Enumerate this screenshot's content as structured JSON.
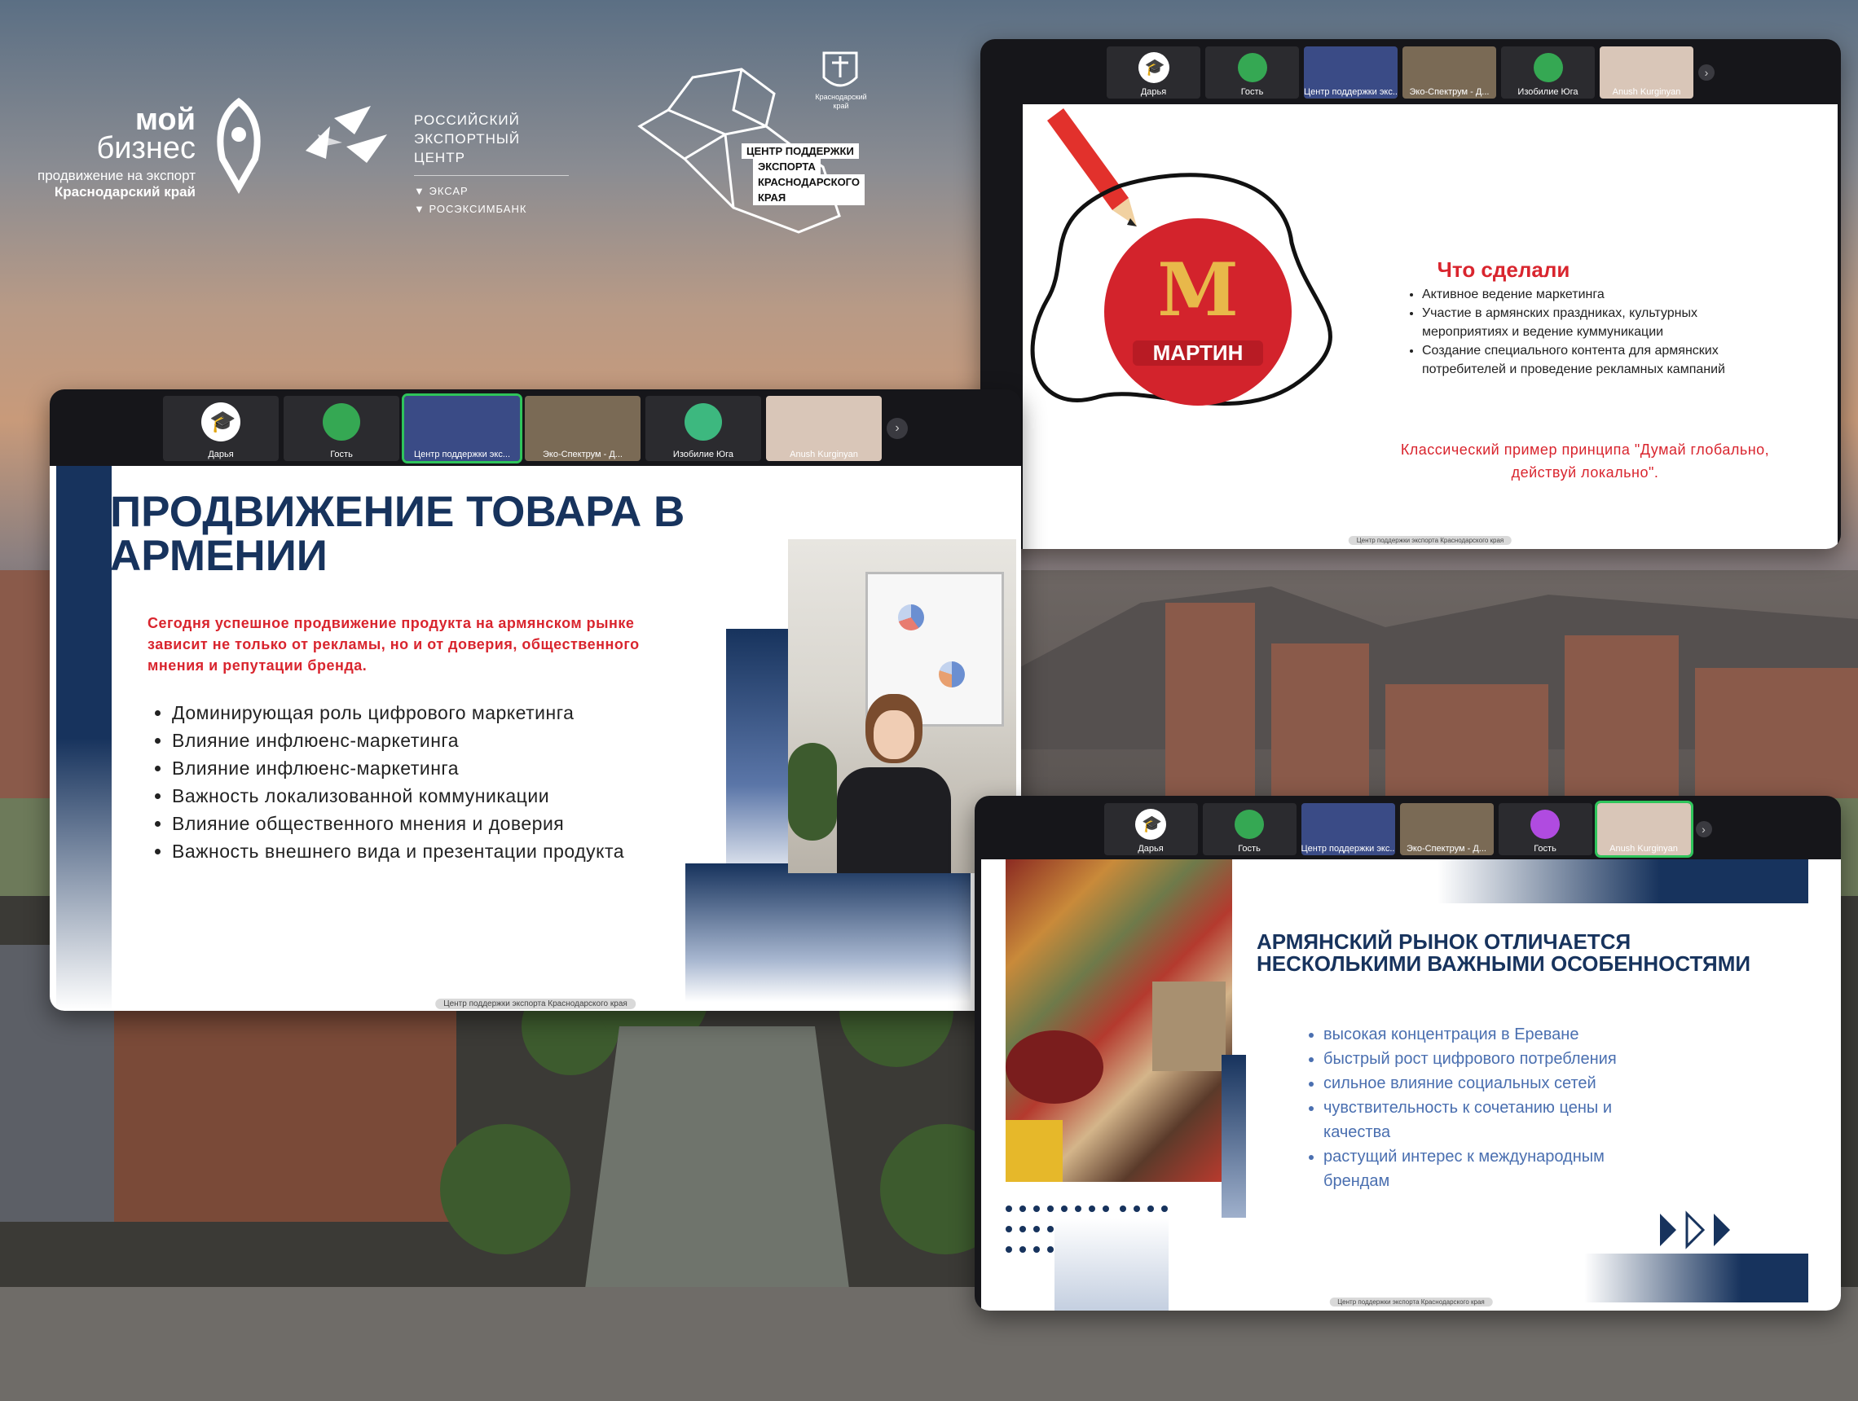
{
  "logos": {
    "moy_biznes_line1": "мой",
    "moy_biznes_line2": "бизнес",
    "moy_biznes_sub1": "продвижение на экспорт",
    "moy_biznes_sub2": "Краснодарский край",
    "rec_line1": "РОССИЙСКИЙ",
    "rec_line2": "ЭКСПОРТНЫЙ ЦЕНТР",
    "exar": "ЭКСАР",
    "roseximbank": "РОСЭКСИМБАНК",
    "center_line1": "ЦЕНТР ПОДДЕРЖКИ",
    "center_line2": "ЭКСПОРТА",
    "center_line3": "КРАСНОДАРСКОГО КРАЯ",
    "kuban_caption": "Краснодарский край"
  },
  "participants_a": [
    "Дарья",
    "Гость",
    "Центр поддержки экс...",
    "Эко-Спектрум - Д...",
    "Изобилие Юга",
    "Anush Kurginyan"
  ],
  "participants_b": [
    "Дарья",
    "Гость",
    "Центр поддержки экс...",
    "Эко-Спектрум - Д...",
    "Изобилие Юга",
    "Anush Kurginyan"
  ],
  "participants_c": [
    "Дарья",
    "Гость",
    "Центр поддержки экс...",
    "Эко-Спектрум - Д...",
    "Гость",
    "Anush Kurginyan"
  ],
  "chevron": "›",
  "slide_martin": {
    "brand": "МАРТИН",
    "brand_letter": "М",
    "title": "Что сделали",
    "bullets": [
      "Активное ведение маркетинга",
      "Участие в армянских праздниках, культурных мероприятиях и ведение куммуникации",
      "Создание специального контента для армянских потребителей и проведение рекламных кампаний"
    ],
    "quote": "Классический пример принципа \"Думай глобально, действуй локально\".",
    "caption": "Центр поддержки экспорта Краснодарского края"
  },
  "slide_promo": {
    "title": "ПРОДВИЖЕНИЕ ТОВАРА В АРМЕНИИ",
    "lead": "Сегодня успешное продвижение продукта на армянском рынке зависит не только от рекламы, но и от доверия, общественного мнения и репутации бренда.",
    "bullets": [
      "Доминирующая роль цифрового маркетинга",
      "Влияние инфлюенс-маркетинга",
      "Влияние инфлюенс-маркетинга",
      "Важность локализованной коммуникации",
      "Влияние общественного мнения и доверия",
      "Важность внешнего вида и презентации продукта"
    ],
    "caption": "Центр поддержки экспорта Краснодарского края"
  },
  "slide_market": {
    "title_line1": "АРМЯНСКИЙ РЫНОК ОТЛИЧАЕТСЯ",
    "title_line2": "НЕСКОЛЬКИМИ ВАЖНЫМИ ОСОБЕННОСТЯМИ",
    "bullets": [
      "высокая концентрация в Ереване",
      "быстрый рост цифрового потребления",
      "сильное влияние социальных сетей",
      "чувствительность к сочетанию цены и качества",
      "растущий интерес к международным брендам"
    ],
    "caption": "Центр поддержки экспорта Краснодарского края"
  },
  "colors": {
    "navy": "#17335d",
    "red": "#d9252e",
    "zoom_bar": "#16161a",
    "active": "#2fc45b"
  }
}
